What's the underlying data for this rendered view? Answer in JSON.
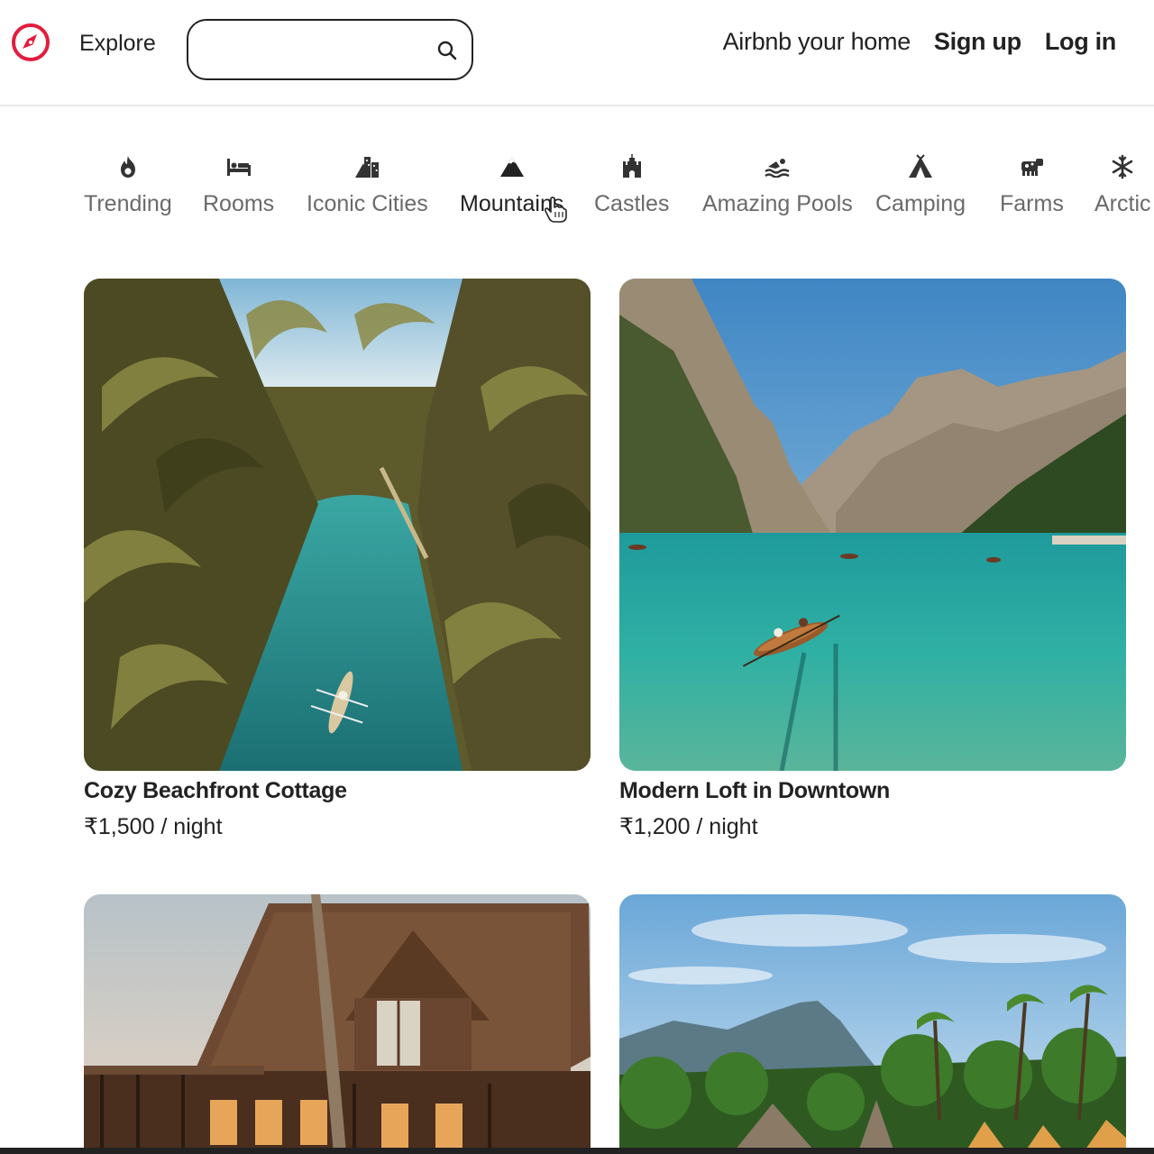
{
  "nav": {
    "logo_icon": "compass-icon",
    "explore_label": "Explore",
    "search": {
      "value": "",
      "placeholder": "",
      "icon": "search-icon"
    },
    "host_label": "Airbnb your home",
    "signup_label": "Sign up",
    "login_label": "Log in"
  },
  "categories": [
    {
      "label": "Trending",
      "icon": "fire-icon",
      "active": false
    },
    {
      "label": "Rooms",
      "icon": "bed-icon",
      "active": false
    },
    {
      "label": "Iconic Cities",
      "icon": "city-icon",
      "active": false
    },
    {
      "label": "Mountains",
      "icon": "mountain-icon",
      "active": true
    },
    {
      "label": "Castles",
      "icon": "castle-icon",
      "active": false
    },
    {
      "label": "Amazing Pools",
      "icon": "swimmer-icon",
      "active": false
    },
    {
      "label": "Camping",
      "icon": "tent-icon",
      "active": false
    },
    {
      "label": "Farms",
      "icon": "cow-icon",
      "active": false
    },
    {
      "label": "Arctic",
      "icon": "snowflake-icon",
      "active": false
    }
  ],
  "listings": [
    {
      "title": "Cozy Beachfront Cottage",
      "price": "₹1,500 / night",
      "image": "palm-lagoon-with-canoe"
    },
    {
      "title": "Modern Loft in Downtown",
      "price": "₹1,200 / night",
      "image": "mountain-lake-with-rowboat"
    },
    {
      "title": "",
      "price": "",
      "image": "wooden-a-frame-lodge"
    },
    {
      "title": "",
      "price": "",
      "image": "tropical-resort-huts"
    }
  ],
  "colors": {
    "brand": "#e31c3d",
    "text": "#222222",
    "muted": "#6a6a6a",
    "border": "#e9e9e9"
  }
}
